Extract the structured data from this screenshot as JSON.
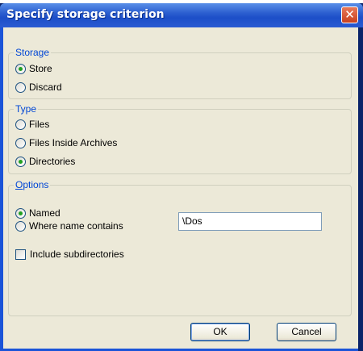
{
  "window": {
    "title": "Specify storage criterion",
    "close_glyph": "✕"
  },
  "storage": {
    "legend": "Storage",
    "options": [
      {
        "label": "Store",
        "selected": true
      },
      {
        "label": "Discard",
        "selected": false
      }
    ]
  },
  "type": {
    "legend": "Type",
    "options": [
      {
        "label": "Files",
        "selected": false
      },
      {
        "label": "Files Inside Archives",
        "selected": false
      },
      {
        "label": "Directories",
        "selected": true
      }
    ]
  },
  "options": {
    "legend_mnemonic": "O",
    "legend_rest": "ptions",
    "match_options": [
      {
        "label": "Named",
        "selected": true
      },
      {
        "label": "Where name contains",
        "selected": false
      }
    ],
    "name_value": "\\Dos",
    "include_subdirectories_label": "Include subdirectories",
    "include_subdirectories_checked": false
  },
  "buttons": {
    "ok": "OK",
    "cancel": "Cancel"
  },
  "colors": {
    "titlebar": "#2c5fd0",
    "dialog_face": "#ece9d8",
    "legend_text": "#0046d5",
    "radio_dot": "#21a121"
  },
  "icons": {
    "close": "close-icon"
  }
}
